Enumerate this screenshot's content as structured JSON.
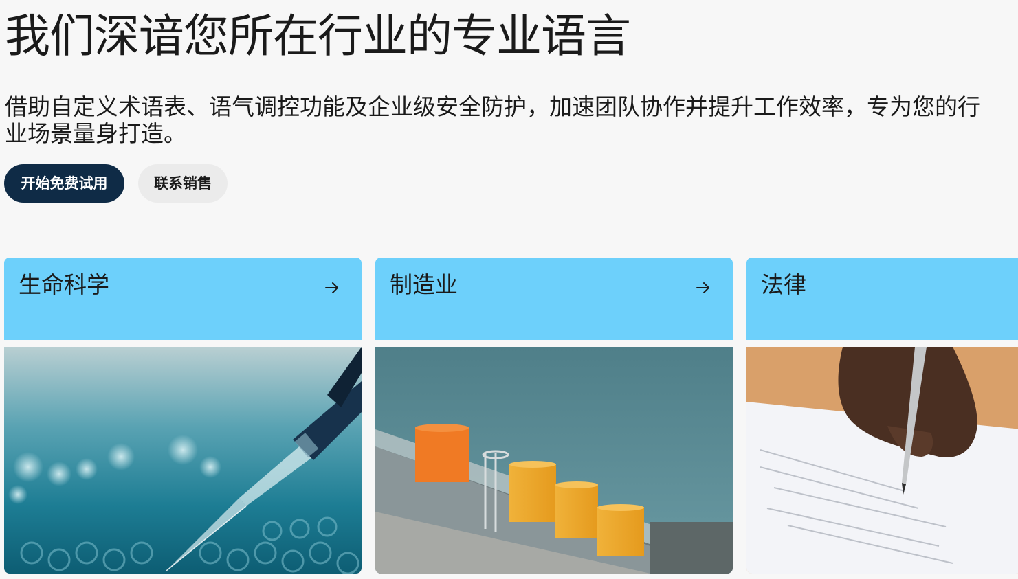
{
  "hero": {
    "headline": "我们深谙您所在行业的专业语言",
    "description": "借助自定义术语表、语气调控功能及企业级安全防护，加速团队协作并提升工作效率，专为您的行业场景量身打造。"
  },
  "actions": {
    "primary_label": "开始免费试用",
    "secondary_label": "联系销售"
  },
  "industries": [
    {
      "title": "生命科学",
      "icon": "arrow-right-icon",
      "image": "pipette-lab-photo"
    },
    {
      "title": "制造业",
      "icon": "arrow-right-icon",
      "image": "rooftop-chimneys-photo"
    },
    {
      "title": "法律",
      "icon": "arrow-right-icon",
      "image": "signing-document-photo"
    }
  ],
  "colors": {
    "background": "#f7f7f7",
    "primary_button": "#0f2b46",
    "secondary_button": "#ebebeb",
    "card_header": "#6dd0fb"
  }
}
